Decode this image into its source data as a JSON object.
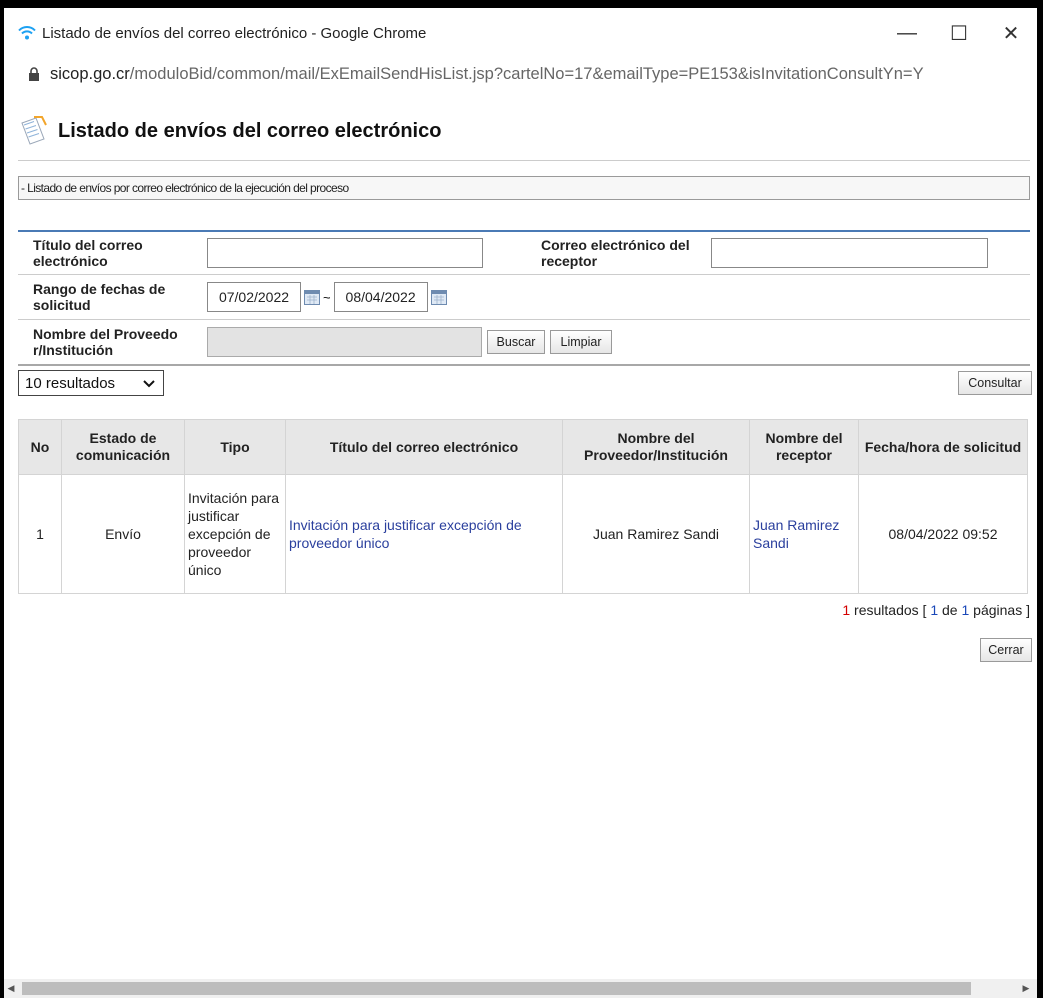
{
  "window": {
    "title": "Listado de envíos del correo electrónico - Google Chrome",
    "minimize": "—",
    "maximize": "☐",
    "close": "✕"
  },
  "address": {
    "host": "sicop.go.cr",
    "path": "/moduloBid/common/mail/ExEmailSendHisList.jsp?cartelNo=17&emailType=PE153&isInvitationConsultYn=Y"
  },
  "page": {
    "title": "Listado de envíos del correo electrónico",
    "subtitle": "- Listado de envíos por correo electrónico de la ejecución del proceso"
  },
  "search": {
    "title_label": "Título del correo electrónico",
    "title_value": "",
    "receiver_label": "Correo electrónico del receptor",
    "receiver_value": "",
    "date_label": "Rango de fechas de solicitud",
    "date_from": "07/02/2022",
    "date_sep": "~",
    "date_to": "08/04/2022",
    "provider_label": "Nombre del Proveedor/Institución",
    "provider_label_line1": "Nombre del Proveedo",
    "provider_label_line2": "r/Institución",
    "provider_value": "",
    "buscar": "Buscar",
    "limpiar": "Limpiar"
  },
  "controls": {
    "page_size": "10 resultados",
    "consultar": "Consultar"
  },
  "table": {
    "headers": {
      "no": "No",
      "estado": "Estado de comunicación",
      "tipo": "Tipo",
      "titulo": "Título del correo electrónico",
      "proveedor": "Nombre del Proveedor/Institución",
      "receptor": "Nombre del receptor",
      "fecha": "Fecha/hora de solicitud"
    },
    "rows": [
      {
        "no": "1",
        "estado": "Envío",
        "tipo": "Invitación para justificar excepción de proveedor único",
        "titulo": "Invitación para justificar excepción de proveedor único",
        "proveedor": "Juan Ramirez Sandi",
        "receptor": "Juan Ramirez Sandi",
        "fecha": "08/04/2022 09:52"
      }
    ]
  },
  "pager": {
    "count": "1",
    "resultados": " resultados [ ",
    "page": "1",
    "de": " de ",
    "total": "1",
    "paginas": " páginas ]"
  },
  "cerrar": "Cerrar",
  "icons": {
    "wifi": "wifi-icon",
    "lock": "lock-icon",
    "page": "notepad-icon",
    "calendar": "calendar-icon",
    "dropdown": "chevron-down-icon"
  },
  "colors": {
    "panel_border": "#4a7ab5",
    "link": "#2a3f9d",
    "count_red": "#d40000"
  }
}
